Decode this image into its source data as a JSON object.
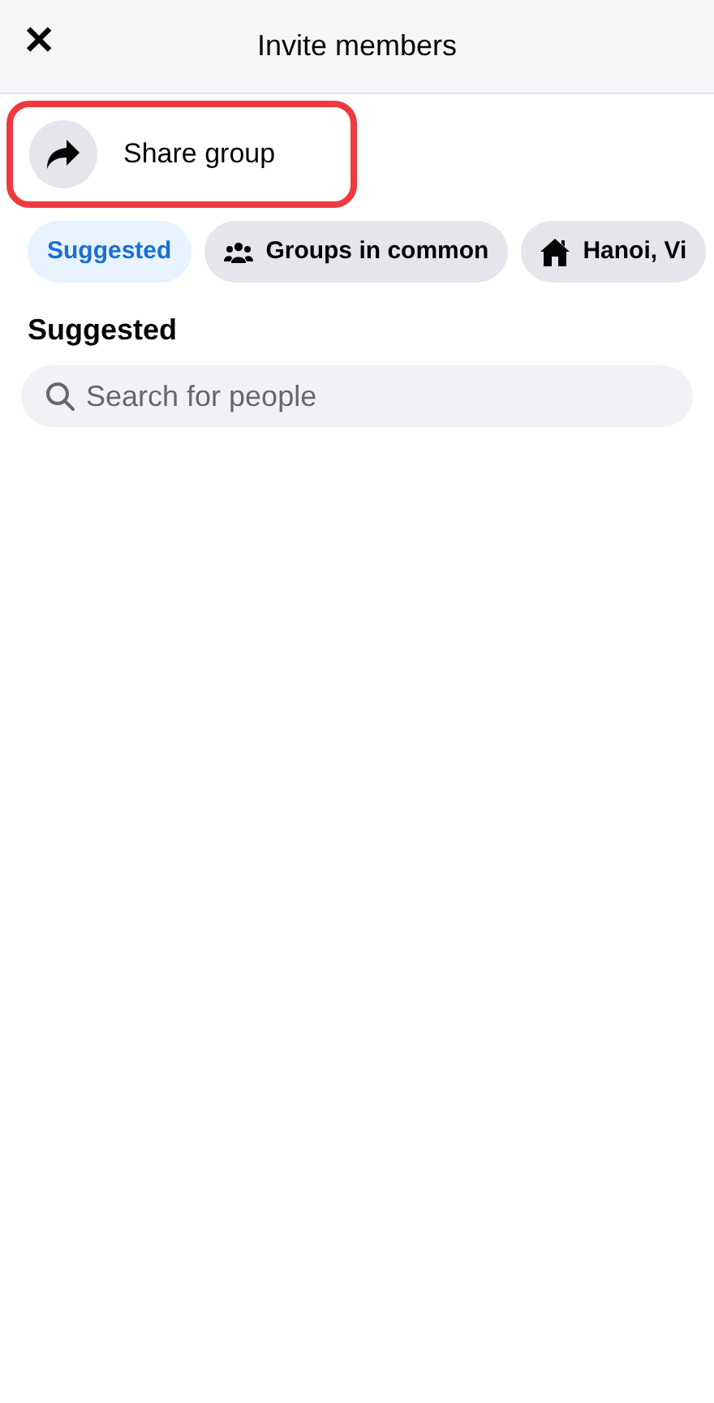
{
  "header": {
    "close": "✕",
    "title": "Invite members"
  },
  "share": {
    "label": "Share group",
    "highlighted": true
  },
  "filters": [
    {
      "kind": "plain",
      "label": "Suggested",
      "selected": true
    },
    {
      "kind": "groups",
      "label": "Groups in common",
      "selected": false
    },
    {
      "kind": "home",
      "label": "Hanoi, Vi",
      "selected": false
    }
  ],
  "section_title": "Suggested",
  "search": {
    "placeholder": "Search for people"
  }
}
